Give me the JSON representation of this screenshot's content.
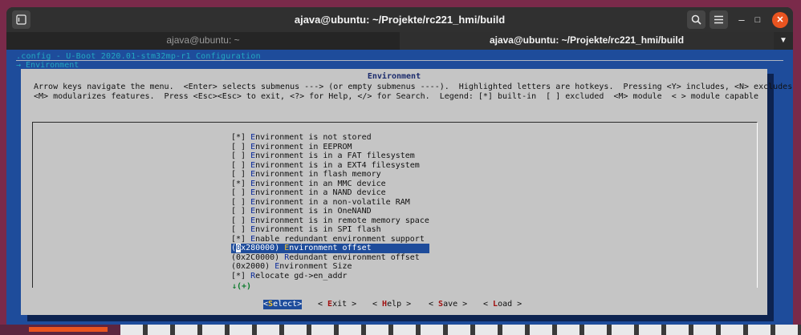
{
  "window": {
    "title": "ajava@ubuntu: ~/Projekte/rc221_hmi/build",
    "new_tab_icon": "terminal-icon",
    "search_icon": "search-icon",
    "menu_icon": "hamburger-icon",
    "minimize": "–",
    "maximize": "□",
    "close": "✕"
  },
  "tabs": [
    {
      "label": "ajava@ubuntu: ~",
      "active": false
    },
    {
      "label": "ajava@ubuntu: ~/Projekte/rc221_hmi/build",
      "active": true
    }
  ],
  "terminal": {
    "breadcrumb": ".config - U-Boot 2020.01-stm32mp-r1 Configuration",
    "breadcrumb_sub": "→ Environment"
  },
  "dialog": {
    "title": "Environment",
    "help_line1": "Arrow keys navigate the menu.  <Enter> selects submenus ---> (or empty submenus ----).  Highlighted letters are hotkeys.  Pressing <Y> includes, <N> excludes,",
    "help_line2": "<M> modularizes features.  Press <Esc><Esc> to exit, <?> for Help, </> for Search.  Legend: [*] built-in  [ ] excluded  <M> module  < > module capable",
    "menu_items": [
      {
        "prefix": "[*] ",
        "hotkey": "E",
        "rest": "nvironment is not stored"
      },
      {
        "prefix": "[ ] ",
        "hotkey": "E",
        "rest": "nvironment in EEPROM"
      },
      {
        "prefix": "[ ] ",
        "hotkey": "E",
        "rest": "nvironment is in a FAT filesystem"
      },
      {
        "prefix": "[ ] ",
        "hotkey": "E",
        "rest": "nvironment is in a EXT4 filesystem"
      },
      {
        "prefix": "[ ] ",
        "hotkey": "E",
        "rest": "nvironment in flash memory"
      },
      {
        "prefix": "[*] ",
        "hotkey": "E",
        "rest": "nvironment in an MMC device"
      },
      {
        "prefix": "[ ] ",
        "hotkey": "E",
        "rest": "nvironment in a NAND device"
      },
      {
        "prefix": "[ ] ",
        "hotkey": "E",
        "rest": "nvironment in a non-volatile RAM"
      },
      {
        "prefix": "[ ] ",
        "hotkey": "E",
        "rest": "nvironment is in OneNAND"
      },
      {
        "prefix": "[ ] ",
        "hotkey": "E",
        "rest": "nvironment is in remote memory space"
      },
      {
        "prefix": "[ ] ",
        "hotkey": "E",
        "rest": "nvironment is in SPI flash"
      },
      {
        "prefix": "[*] ",
        "hotkey": "E",
        "rest": "nable redundant environment support"
      },
      {
        "prefix": "(0x280000) ",
        "hotkey": "E",
        "rest": "nvironment offset",
        "selected": true
      },
      {
        "prefix": "(0x2C0000) ",
        "hotkey": "R",
        "rest": "edundant environment offset"
      },
      {
        "prefix": "(0x2000) ",
        "hotkey": "E",
        "rest": "nvironment Size"
      },
      {
        "prefix": "[*] ",
        "hotkey": "R",
        "rest": "elocate gd->en_addr"
      }
    ],
    "more_indicator": "↓(+)",
    "buttons": [
      {
        "pre": "<",
        "hotkey": "S",
        "rest": "elect>",
        "active": true
      },
      {
        "pre": "< ",
        "hotkey": "E",
        "rest": "xit >",
        "active": false
      },
      {
        "pre": "< ",
        "hotkey": "H",
        "rest": "elp >",
        "active": false
      },
      {
        "pre": "< ",
        "hotkey": "S",
        "rest": "ave >",
        "active": false
      },
      {
        "pre": "< ",
        "hotkey": "L",
        "rest": "oad >",
        "active": false
      }
    ]
  }
}
